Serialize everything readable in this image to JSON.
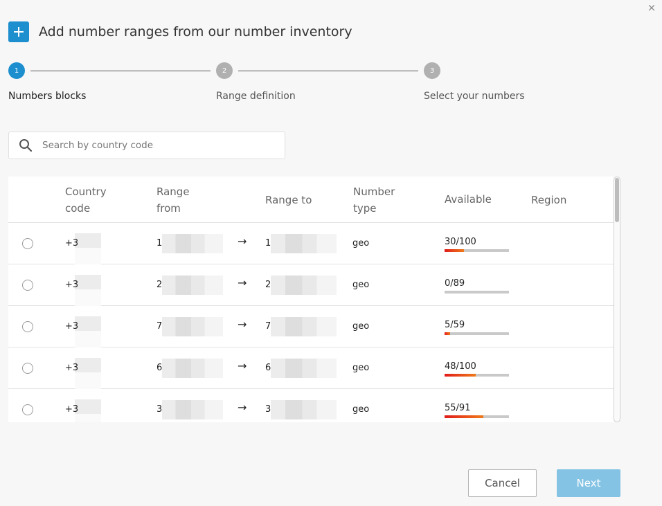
{
  "dialog": {
    "title": "Add number ranges from our number inventory",
    "close_glyph": "×",
    "accent": "#1d8fcf"
  },
  "stepper": {
    "steps": [
      {
        "number": "1",
        "label": "Numbers blocks",
        "active": true
      },
      {
        "number": "2",
        "label": "Range definition",
        "active": false
      },
      {
        "number": "3",
        "label": "Select your numbers",
        "active": false
      }
    ]
  },
  "search": {
    "placeholder": "Search by country code",
    "value": ""
  },
  "table": {
    "columns": {
      "country_code": [
        "Country",
        "code"
      ],
      "range_from": [
        "Range",
        "from"
      ],
      "range_to": "Range to",
      "number_type": [
        "Number",
        "type"
      ],
      "available": "Available",
      "region": "Region"
    },
    "arrow_glyph": "→",
    "rows": [
      {
        "country_code": "+3",
        "range_from": "1",
        "range_to": "1",
        "number_type": "geo",
        "available": "30/100",
        "available_fraction": 0.3,
        "region": ""
      },
      {
        "country_code": "+3",
        "range_from": "2",
        "range_to": "2",
        "number_type": "geo",
        "available": "0/89",
        "available_fraction": 0.0,
        "region": ""
      },
      {
        "country_code": "+3",
        "range_from": "7",
        "range_to": "7",
        "number_type": "geo",
        "available": "5/59",
        "available_fraction": 0.085,
        "region": ""
      },
      {
        "country_code": "+3",
        "range_from": "6",
        "range_to": "6",
        "number_type": "geo",
        "available": "48/100",
        "available_fraction": 0.48,
        "region": ""
      },
      {
        "country_code": "+3",
        "range_from": "3",
        "range_to": "3",
        "number_type": "geo",
        "available": "55/91",
        "available_fraction": 0.6,
        "region": ""
      }
    ]
  },
  "footer": {
    "cancel_label": "Cancel",
    "next_label": "Next"
  }
}
